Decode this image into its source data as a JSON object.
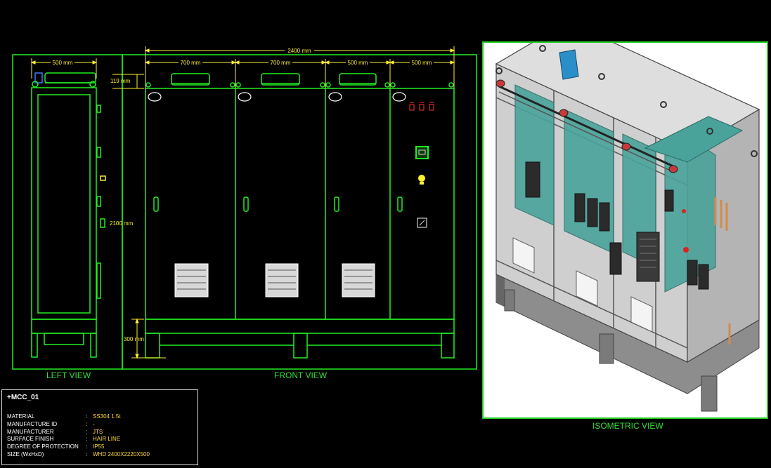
{
  "views": {
    "left_label": "LEFT VIEW",
    "front_label": "FRONT VIEW",
    "iso_label": "ISOMETRIC VIEW"
  },
  "dimensions": {
    "left_width": "500 mm",
    "total_width": "2400 mm",
    "panel1": "700 mm",
    "panel2": "700 mm",
    "panel3": "500 mm",
    "panel4": "500 mm",
    "top_height": "119 mm",
    "height": "2100 mm",
    "base_height": "300 mm"
  },
  "panel_marks": {
    "meter_label": "",
    "door_badges": [
      "",
      "",
      "",
      ""
    ]
  },
  "title_block": {
    "tag": "+MCC_01",
    "rows": [
      {
        "key": "MATERIAL",
        "value": "SS304 1.5t"
      },
      {
        "key": "MANUFACTURE ID",
        "value": "-"
      },
      {
        "key": "MANUFACTURER",
        "value": "JTS"
      },
      {
        "key": "SURFACE FINISH",
        "value": "HAIR LINE"
      },
      {
        "key": "DEGREE OF PROTECTION",
        "value": "IP55"
      },
      {
        "key": "SIZE (WxHxD)",
        "value": "WHD 2400X2220X500"
      }
    ],
    "separator": ":"
  },
  "colors": {
    "outline": "#22ee22",
    "dimension": "#ffee33",
    "panel_bg": "#000000",
    "iso_bg": "#ffffff",
    "cabinet_grey": "#b9b9b9",
    "mounting_teal": "#4aa39a"
  }
}
